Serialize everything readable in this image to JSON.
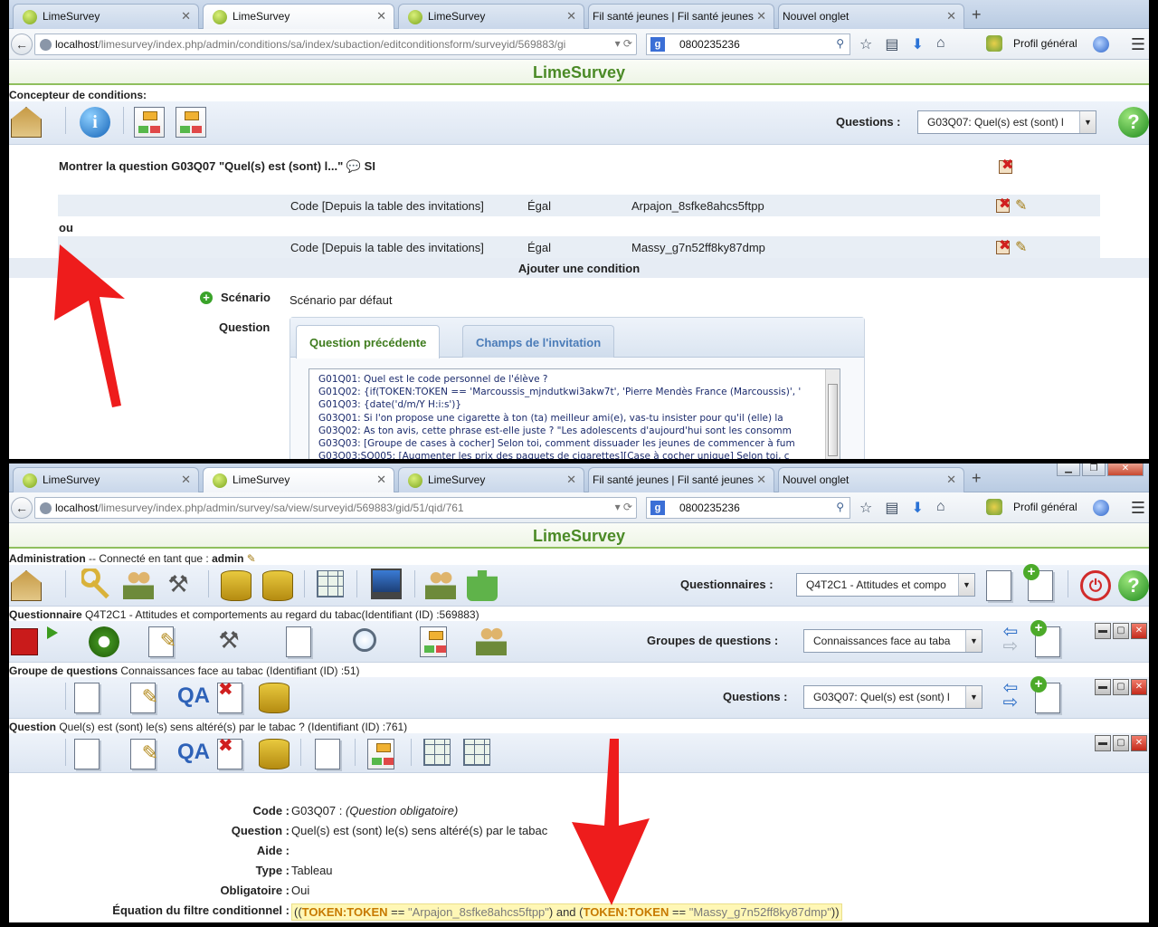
{
  "browser": {
    "tabs": [
      "LimeSurvey",
      "LimeSurvey",
      "LimeSurvey",
      "Fil santé jeunes | Fil santé jeunes",
      "Nouvel onglet"
    ],
    "search_value": "0800235236",
    "profile": "Profil général"
  },
  "top": {
    "url_host": "localhost",
    "url_path": "/limesurvey/index.php/admin/conditions/sa/index/subaction/editconditionsform/surveyid/569883/gi",
    "app_title": "LimeSurvey",
    "designer_label": "Concepteur de conditions:",
    "questions_label": "Questions :",
    "questions_selected": "G03Q07: Quel(s) est (sont) l",
    "show_question": "Montrer la question G03Q07 \"Quel(s) est (sont) l...\" 💬 SI",
    "conditions": [
      {
        "field": "Code [Depuis la table des invitations]",
        "op": "Égal",
        "value": "Arpajon_8sfke8ahcs5ftpp"
      },
      {
        "field": "Code [Depuis la table des invitations]",
        "op": "Égal",
        "value": "Massy_g7n52ff8ky87dmp"
      }
    ],
    "or_label": "ou",
    "add_condition": "Ajouter une condition",
    "scenario_label": "Scénario",
    "scenario_value": "Scénario par défaut",
    "question_label": "Question",
    "tab_prev": "Question précédente",
    "tab_invite": "Champs de l'invitation",
    "question_list": [
      "G01Q01: Quel est le code personnel de l'élève ?",
      "G01Q02: {if(TOKEN:TOKEN == 'Marcoussis_mjndutkwi3akw7t', 'Pierre Mendès France (Marcoussis)', '",
      "G01Q03: {date('d/m/Y H:i:s')}",
      "G03Q01: Si l'on propose une cigarette à ton (ta) meilleur ami(e), vas-tu insister pour qu'il (elle) la",
      "G03Q02: As ton avis, cette phrase est-elle juste ? \"Les adolescents d'aujourd'hui sont les consomm",
      "G03Q03: [Groupe de cases à cocher] Selon toi, comment dissuader les jeunes de commencer à fum",
      "G03Q03:SQ005: [Augmenter les prix des paquets de cigarettes][Case à cocher unique] Selon toi, c"
    ]
  },
  "bottom": {
    "url_host": "localhost",
    "url_path": "/limesurvey/index.php/admin/survey/sa/view/surveyid/569883/gid/51/qid/761",
    "app_title": "LimeSurvey",
    "admin_label": "Administration",
    "admin_connected": " -- Connecté en tant que : ",
    "admin_user": "admin",
    "questionnaires_label": "Questionnaires :",
    "questionnaires_selected": "Q4T2C1 - Attitudes et compo",
    "survey_label": "Questionnaire",
    "survey_text": " Q4T2C1 - Attitudes et comportements au regard du tabac(Identifiant (ID) :569883)",
    "groups_label": "Groupes de questions :",
    "groups_selected": "Connaissances face au taba",
    "group_label": "Groupe de questions",
    "group_text": "  Connaissances face au tabac (Identifiant (ID) :51)",
    "questions_label": "Questions :",
    "questions_selected": "G03Q07: Quel(s) est (sont) l",
    "question_label": "Question",
    "question_text": " Quel(s) est (sont) le(s) sens altéré(s) par le tabac ? (Identifiant (ID) :761)",
    "details": {
      "code_k": "Code :",
      "code_v": "G03Q07 : ",
      "code_note": "(Question obligatoire)",
      "question_k": "Question :",
      "question_v": "Quel(s) est (sont) le(s) sens altéré(s) par le tabac",
      "aide_k": "Aide :",
      "type_k": "Type :",
      "type_v": "Tableau",
      "oblig_k": "Obligatoire :",
      "oblig_v": "Oui",
      "eq_k": "Équation du filtre conditionnel :",
      "eq_open": "((",
      "eq_tok1": "TOKEN:TOKEN",
      "eq_op1": " == ",
      "eq_str1": "\"Arpajon_8sfke8ahcs5ftpp\"",
      "eq_mid": ") and (",
      "eq_tok2": "TOKEN:TOKEN",
      "eq_op2": " == ",
      "eq_str2": "\"Massy_g7n52ff8ky87dmp\"",
      "eq_close": "))"
    }
  }
}
